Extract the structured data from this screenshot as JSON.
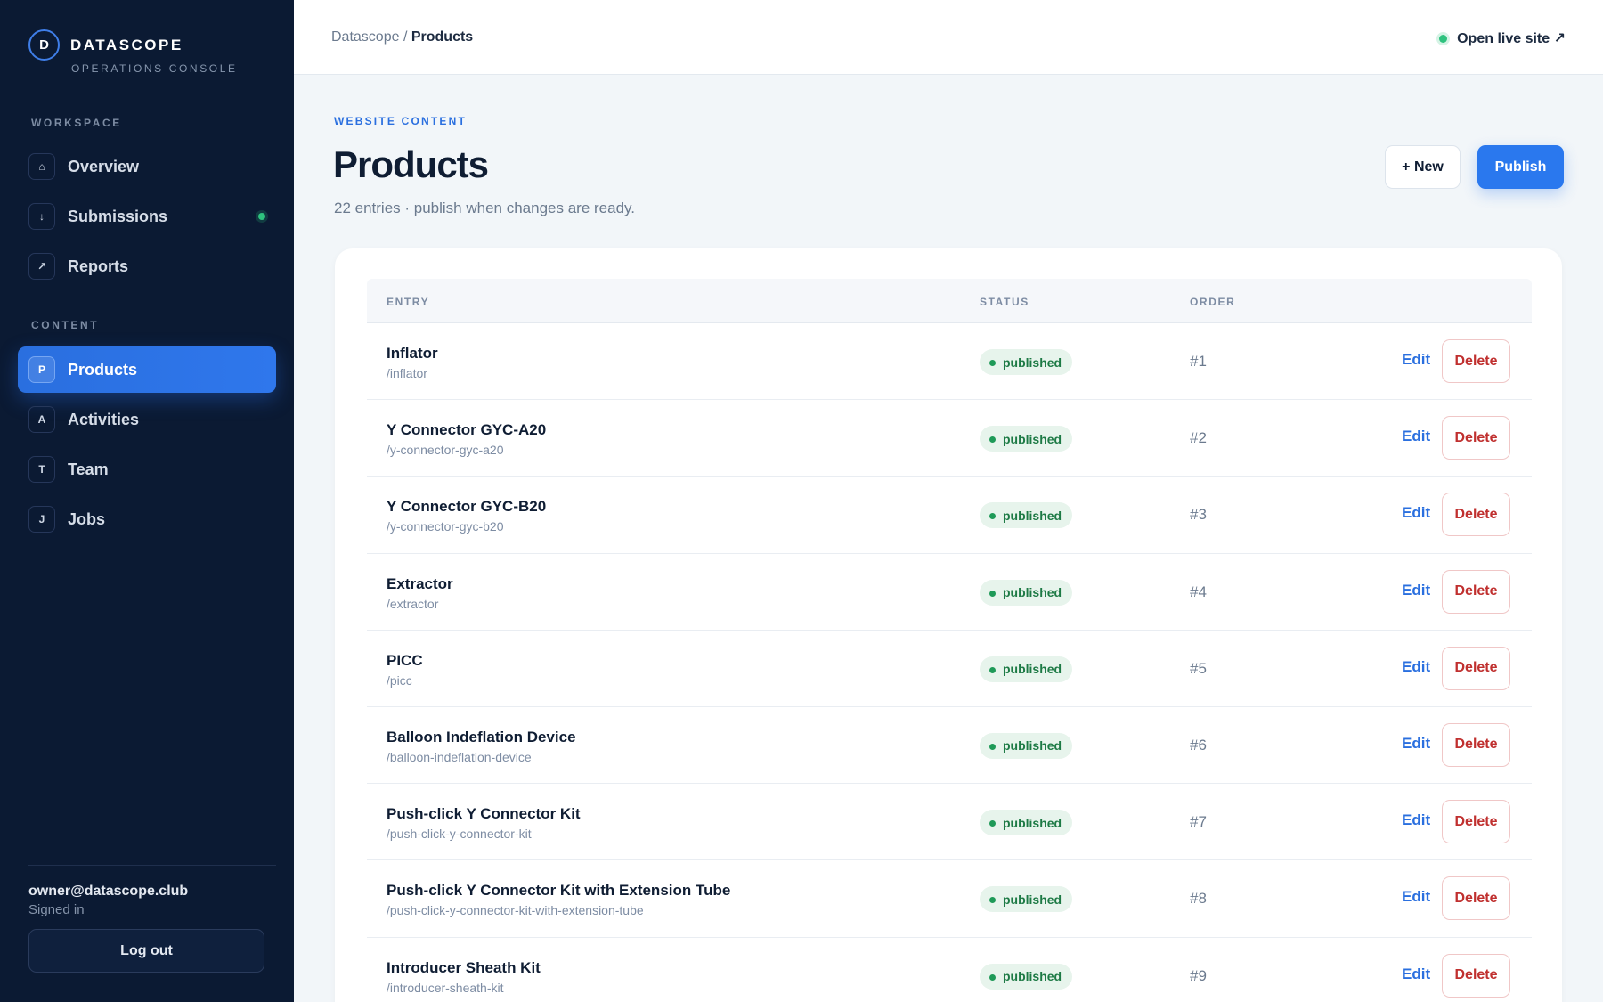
{
  "brand": {
    "logo_letter": "D",
    "name": "DATASCOPE",
    "subtitle": "OPERATIONS CONSOLE"
  },
  "sidebar": {
    "workspace_heading": "WORKSPACE",
    "workspace_items": [
      {
        "label": "Overview",
        "icon": "⌂",
        "icon_name": "home-icon"
      },
      {
        "label": "Submissions",
        "icon": "↓",
        "icon_name": "download-arrow-icon",
        "indicator": true
      },
      {
        "label": "Reports",
        "icon": "↗",
        "icon_name": "trend-arrow-icon"
      }
    ],
    "content_heading": "CONTENT",
    "content_items": [
      {
        "label": "Products",
        "icon": "P",
        "active": true
      },
      {
        "label": "Activities",
        "icon": "A"
      },
      {
        "label": "Team",
        "icon": "T"
      },
      {
        "label": "Jobs",
        "icon": "J"
      }
    ],
    "user": {
      "email": "owner@datascope.club",
      "status": "Signed in",
      "logout_label": "Log out"
    }
  },
  "topbar": {
    "breadcrumb_root": "Datascope",
    "breadcrumb_sep": " / ",
    "breadcrumb_current": "Products",
    "live_link_label": "Open live site ↗",
    "live_status_color": "#2ec27e"
  },
  "page": {
    "eyebrow": "WEBSITE CONTENT",
    "title": "Products",
    "subtitle": "22 entries · publish when changes are ready.",
    "new_button": "+ New",
    "publish_button": "Publish",
    "accent_color": "#2a78ee"
  },
  "table": {
    "columns": {
      "entry": "ENTRY",
      "status": "STATUS",
      "order": "ORDER"
    },
    "edit_label": "Edit",
    "delete_label": "Delete",
    "rows": [
      {
        "name": "Inflator",
        "slug": "/inflator",
        "status": "published",
        "order": "#1"
      },
      {
        "name": "Y Connector GYC-A20",
        "slug": "/y-connector-gyc-a20",
        "status": "published",
        "order": "#2"
      },
      {
        "name": "Y Connector GYC-B20",
        "slug": "/y-connector-gyc-b20",
        "status": "published",
        "order": "#3"
      },
      {
        "name": "Extractor",
        "slug": "/extractor",
        "status": "published",
        "order": "#4"
      },
      {
        "name": "PICC",
        "slug": "/picc",
        "status": "published",
        "order": "#5"
      },
      {
        "name": "Balloon Indeflation Device",
        "slug": "/balloon-indeflation-device",
        "status": "published",
        "order": "#6"
      },
      {
        "name": "Push-click Y Connector Kit",
        "slug": "/push-click-y-connector-kit",
        "status": "published",
        "order": "#7"
      },
      {
        "name": "Push-click Y Connector Kit with Extension Tube",
        "slug": "/push-click-y-connector-kit-with-extension-tube",
        "status": "published",
        "order": "#8"
      },
      {
        "name": "Introducer Sheath Kit",
        "slug": "/introducer-sheath-kit",
        "status": "published",
        "order": "#9"
      }
    ]
  }
}
